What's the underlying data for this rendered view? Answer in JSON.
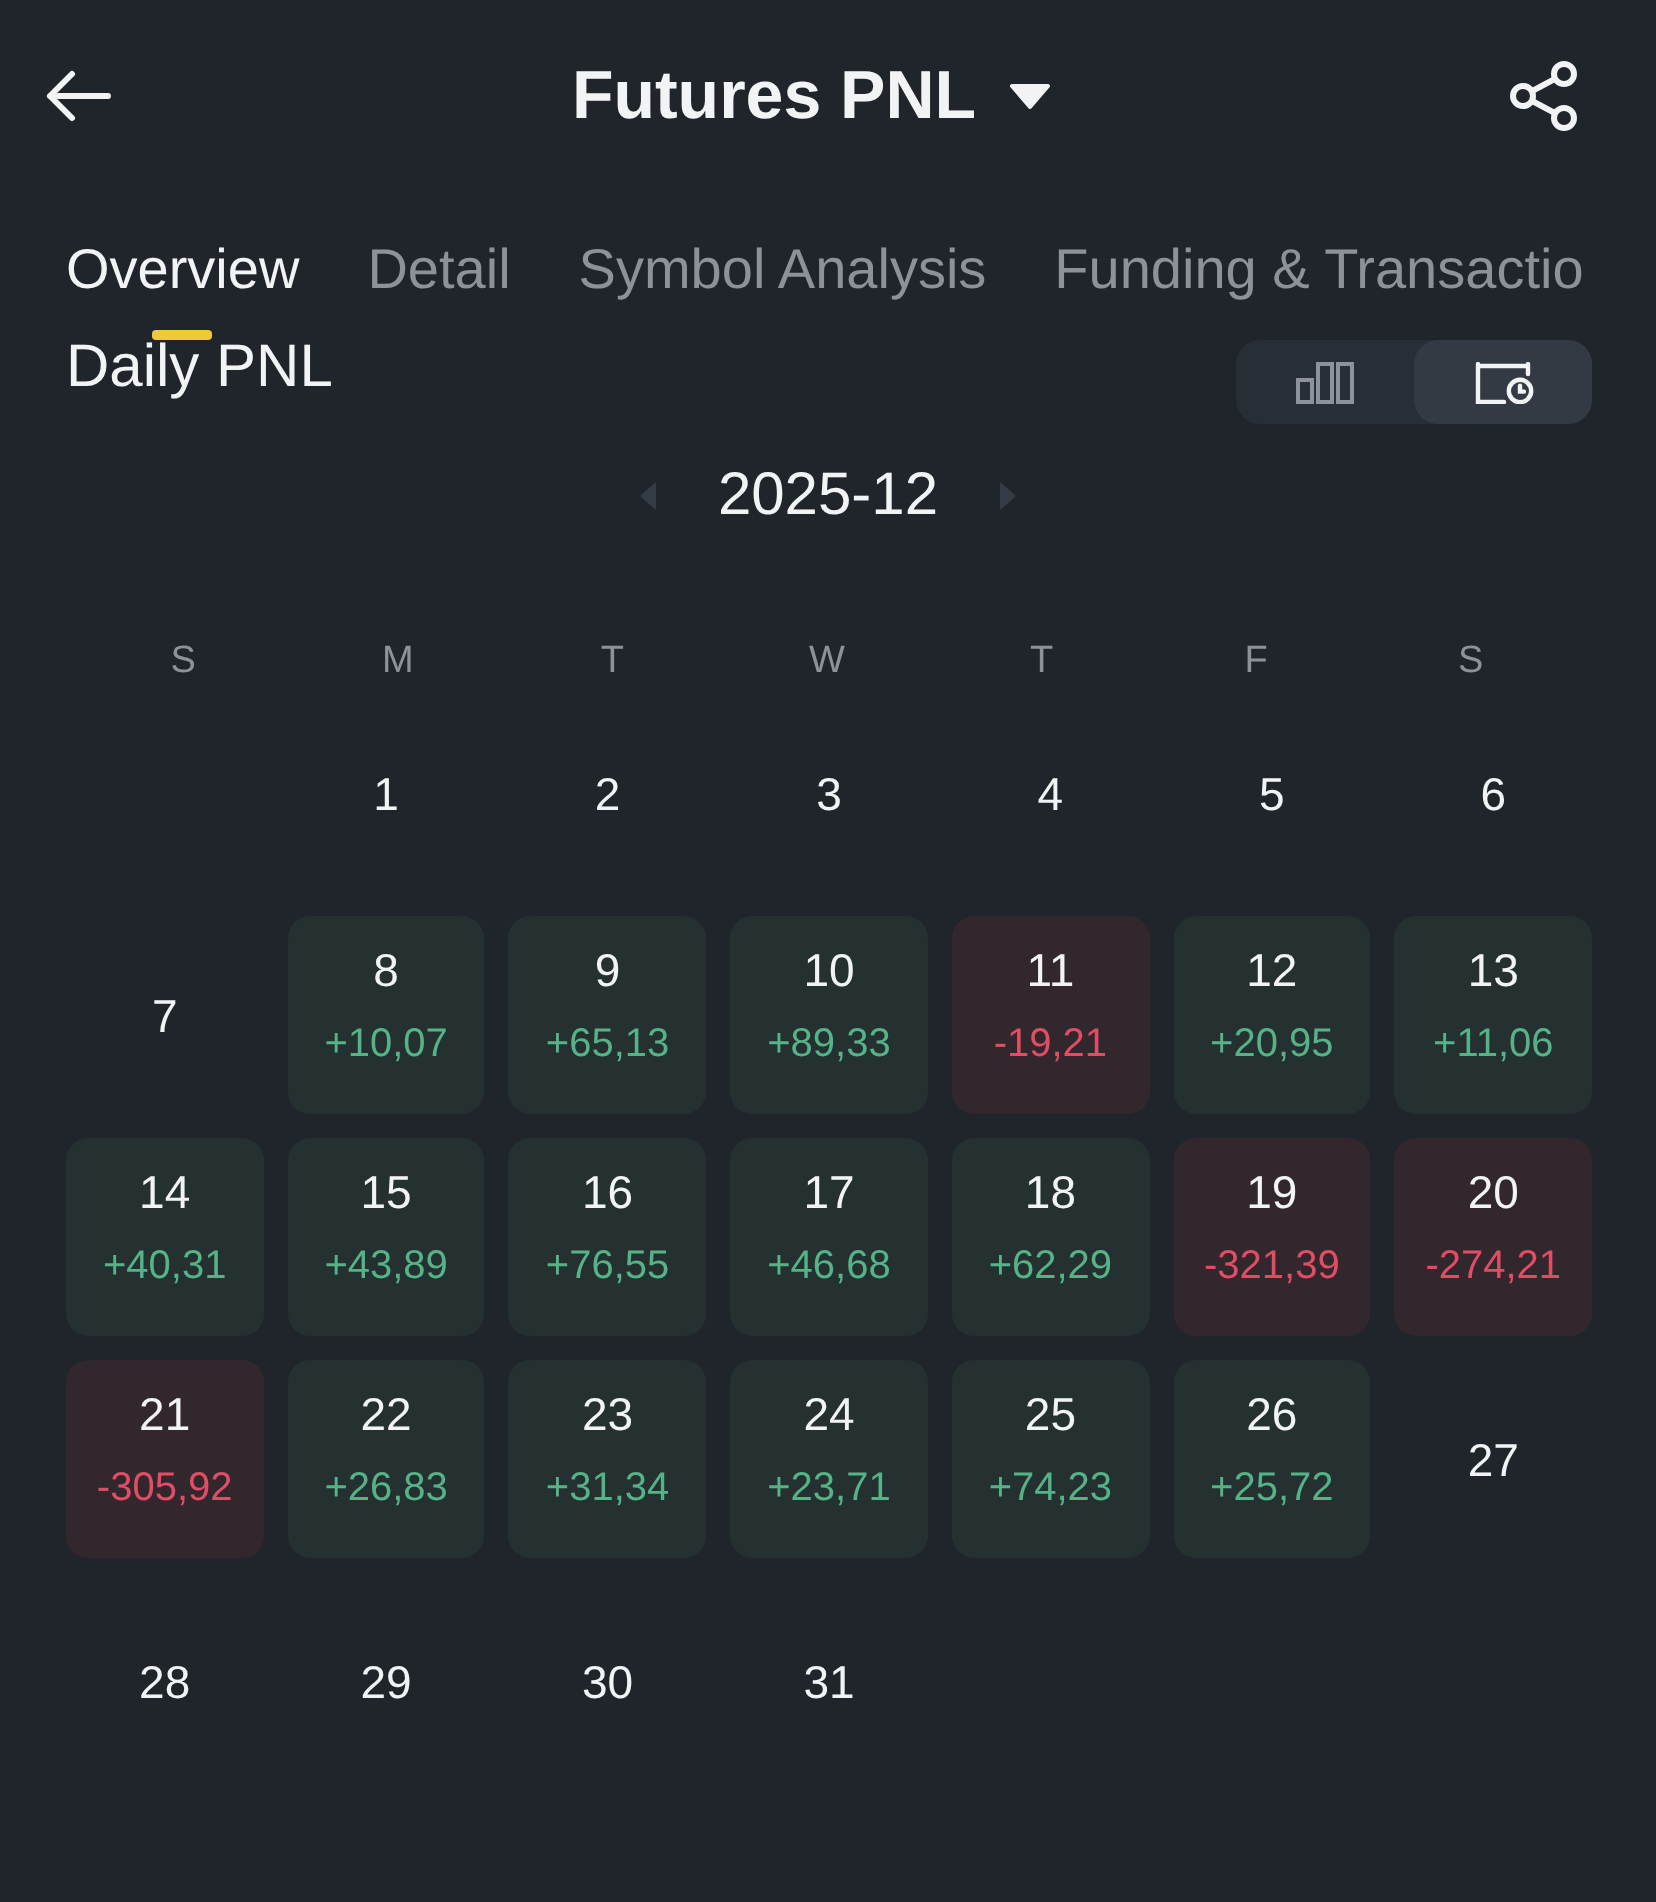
{
  "header": {
    "title": "Futures PNL"
  },
  "tabs": [
    {
      "label": "Overview",
      "selected": true
    },
    {
      "label": "Detail",
      "selected": false
    },
    {
      "label": "Symbol Analysis",
      "selected": false
    },
    {
      "label": "Funding & Transactio",
      "selected": false
    }
  ],
  "section": {
    "title": "Daily PNL",
    "view_toggle": [
      {
        "kind": "chart",
        "selected": false
      },
      {
        "kind": "calendar",
        "selected": true
      }
    ]
  },
  "calendar": {
    "month": "2025-12",
    "weekdays": [
      "S",
      "M",
      "T",
      "W",
      "T",
      "F",
      "S"
    ],
    "weeks": [
      {
        "days": [
          {
            "kind": "empty"
          },
          {
            "kind": "plain",
            "day": "1"
          },
          {
            "kind": "plain",
            "day": "2"
          },
          {
            "kind": "plain",
            "day": "3"
          },
          {
            "kind": "plain",
            "day": "4"
          },
          {
            "kind": "plain",
            "day": "5"
          },
          {
            "kind": "plain",
            "day": "6"
          }
        ]
      },
      {
        "days": [
          {
            "kind": "plain",
            "day": "7"
          },
          {
            "kind": "profit",
            "day": "8",
            "pnl": "+10,07"
          },
          {
            "kind": "profit",
            "day": "9",
            "pnl": "+65,13"
          },
          {
            "kind": "profit",
            "day": "10",
            "pnl": "+89,33"
          },
          {
            "kind": "loss",
            "day": "11",
            "pnl": "-19,21"
          },
          {
            "kind": "profit",
            "day": "12",
            "pnl": "+20,95"
          },
          {
            "kind": "profit",
            "day": "13",
            "pnl": "+11,06"
          }
        ]
      },
      {
        "days": [
          {
            "kind": "profit",
            "day": "14",
            "pnl": "+40,31"
          },
          {
            "kind": "profit",
            "day": "15",
            "pnl": "+43,89"
          },
          {
            "kind": "profit",
            "day": "16",
            "pnl": "+76,55"
          },
          {
            "kind": "profit",
            "day": "17",
            "pnl": "+46,68"
          },
          {
            "kind": "profit",
            "day": "18",
            "pnl": "+62,29"
          },
          {
            "kind": "loss",
            "day": "19",
            "pnl": "-321,39"
          },
          {
            "kind": "loss",
            "day": "20",
            "pnl": "-274,21"
          }
        ]
      },
      {
        "days": [
          {
            "kind": "loss",
            "day": "21",
            "pnl": "-305,92"
          },
          {
            "kind": "profit",
            "day": "22",
            "pnl": "+26,83"
          },
          {
            "kind": "profit",
            "day": "23",
            "pnl": "+31,34"
          },
          {
            "kind": "profit",
            "day": "24",
            "pnl": "+23,71"
          },
          {
            "kind": "profit",
            "day": "25",
            "pnl": "+74,23"
          },
          {
            "kind": "profit",
            "day": "26",
            "pnl": "+25,72"
          },
          {
            "kind": "plain",
            "day": "27"
          }
        ]
      },
      {
        "days": [
          {
            "kind": "plain",
            "day": "28"
          },
          {
            "kind": "plain",
            "day": "29"
          },
          {
            "kind": "plain",
            "day": "30"
          },
          {
            "kind": "plain",
            "day": "31"
          }
        ]
      }
    ]
  }
}
